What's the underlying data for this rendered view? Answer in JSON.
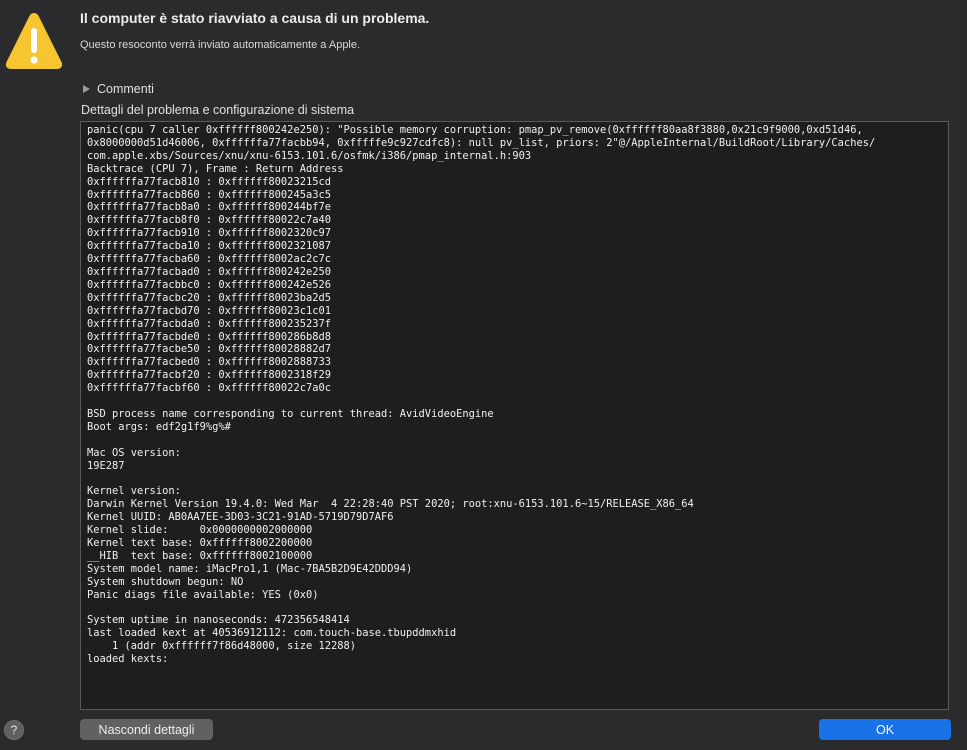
{
  "colors": {
    "window_bg": "#2b2b2d",
    "log_bg": "#1e1e1e",
    "accent": "#1a72e8",
    "warning_yellow": "#f6c530"
  },
  "header": {
    "icon": "warning-triangle-icon",
    "title": "Il computer è stato riavviato a causa di un problema.",
    "subtitle": "Questo resoconto verrà inviato automaticamente a Apple."
  },
  "comments": {
    "icon": "disclosure-triangle-icon",
    "label": "Commenti"
  },
  "details": {
    "label": "Dettagli del problema e configurazione di sistema",
    "log": "panic(cpu 7 caller 0xffffff800242e250): \"Possible memory corruption: pmap_pv_remove(0xffffff80aa8f3880,0x21c9f9000,0xd51d46,\n0x8000000d51d46006, 0xffffffa77facbb94, 0xfffffe9c927cdfc8): null pv_list, priors: 2\"@/AppleInternal/BuildRoot/Library/Caches/\ncom.apple.xbs/Sources/xnu/xnu-6153.101.6/osfmk/i386/pmap_internal.h:903\nBacktrace (CPU 7), Frame : Return Address\n0xffffffa77facb810 : 0xffffff80023215cd\n0xffffffa77facb860 : 0xffffff800245a3c5\n0xffffffa77facb8a0 : 0xffffff800244bf7e\n0xffffffa77facb8f0 : 0xffffff80022c7a40\n0xffffffa77facb910 : 0xffffff8002320c97\n0xffffffa77facba10 : 0xffffff8002321087\n0xffffffa77facba60 : 0xffffff8002ac2c7c\n0xffffffa77facbad0 : 0xffffff800242e250\n0xffffffa77facbbc0 : 0xffffff800242e526\n0xffffffa77facbc20 : 0xffffff80023ba2d5\n0xffffffa77facbd70 : 0xffffff80023c1c01\n0xffffffa77facbda0 : 0xffffff800235237f\n0xffffffa77facbde0 : 0xffffff800286b8d8\n0xffffffa77facbe50 : 0xffffff80028882d7\n0xffffffa77facbed0 : 0xffffff8002888733\n0xffffffa77facbf20 : 0xffffff8002318f29\n0xffffffa77facbf60 : 0xffffff80022c7a0c\n\nBSD process name corresponding to current thread: AvidVideoEngine\nBoot args: edf2g1f9%g%#\n\nMac OS version:\n19E287\n\nKernel version:\nDarwin Kernel Version 19.4.0: Wed Mar  4 22:28:40 PST 2020; root:xnu-6153.101.6~15/RELEASE_X86_64\nKernel UUID: AB0AA7EE-3D03-3C21-91AD-5719D79D7AF6\nKernel slide:     0x0000000002000000\nKernel text base: 0xffffff8002200000\n__HIB  text base: 0xffffff8002100000\nSystem model name: iMacPro1,1 (Mac-7BA5B2D9E42DDD94)\nSystem shutdown begun: NO\nPanic diags file available: YES (0x0)\n\nSystem uptime in nanoseconds: 472356548414\nlast loaded kext at 40536912112: com.touch-base.tbupddmxhid\n    1 (addr 0xffffff7f86d48000, size 12288)\nloaded kexts:"
  },
  "footer": {
    "help_label": "?",
    "hide_details_label": "Nascondi dettagli",
    "ok_label": "OK"
  }
}
